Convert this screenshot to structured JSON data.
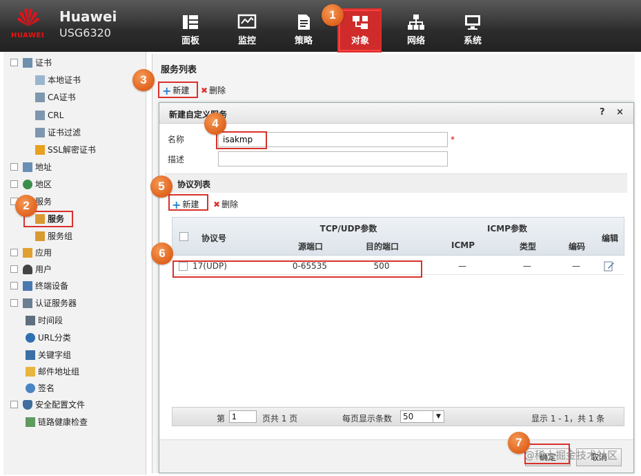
{
  "brand": {
    "logo_text": "HUAWEI",
    "name": "Huawei",
    "model": "USG6320"
  },
  "nav": [
    {
      "label": "面板",
      "icon": "dashboard-icon"
    },
    {
      "label": "监控",
      "icon": "monitor-icon"
    },
    {
      "label": "策略",
      "icon": "policy-icon"
    },
    {
      "label": "对象",
      "icon": "object-icon",
      "active": true
    },
    {
      "label": "网络",
      "icon": "network-icon"
    },
    {
      "label": "系统",
      "icon": "system-icon"
    }
  ],
  "tree": [
    {
      "label": "证书"
    },
    {
      "label": "本地证书"
    },
    {
      "label": "CA证书"
    },
    {
      "label": "CRL"
    },
    {
      "label": "证书过滤"
    },
    {
      "label": "SSL解密证书"
    },
    {
      "label": "地址"
    },
    {
      "label": "地区"
    },
    {
      "label": "服务"
    },
    {
      "label": "服务"
    },
    {
      "label": "服务组"
    },
    {
      "label": "应用"
    },
    {
      "label": "用户"
    },
    {
      "label": "终端设备"
    },
    {
      "label": "认证服务器"
    },
    {
      "label": "时间段"
    },
    {
      "label": "URL分类"
    },
    {
      "label": "关键字组"
    },
    {
      "label": "邮件地址组"
    },
    {
      "label": "签名"
    },
    {
      "label": "安全配置文件"
    },
    {
      "label": "链路健康检查"
    }
  ],
  "main": {
    "title": "服务列表",
    "new_label": "新建",
    "delete_label": "删除"
  },
  "dialog": {
    "title": "新建自定义服务",
    "help": "?",
    "close": "×",
    "name_label": "名称",
    "name_value": "isakmp",
    "required": "*",
    "desc_label": "描述",
    "desc_value": "",
    "protocol_section": "协议列表",
    "new_label": "新建",
    "delete_label": "删除",
    "table": {
      "h_protocol": "协议号",
      "h_tcpudp": "TCP/UDP参数",
      "h_src": "源端口",
      "h_dst": "目的端口",
      "h_icmp_group": "ICMP参数",
      "h_icmp": "ICMP",
      "h_type": "类型",
      "h_code": "编码",
      "h_edit": "编辑",
      "rows": [
        {
          "protocol": "17(UDP)",
          "src": "0-65535",
          "dst": "500",
          "icmp": "—",
          "type": "—",
          "code": "—"
        }
      ]
    },
    "pager": {
      "page_label": "第",
      "page_value": "1",
      "total": "页共 1 页",
      "per_page_label": "每页显示条数",
      "per_page_value": "50",
      "summary": "显示 1 - 1，共 1 条"
    },
    "ok_label": "确定",
    "cancel_label": "取消"
  },
  "markers": [
    "1",
    "2",
    "3",
    "4",
    "5",
    "6",
    "7"
  ],
  "watermark": "@稀土掘金技术社区"
}
